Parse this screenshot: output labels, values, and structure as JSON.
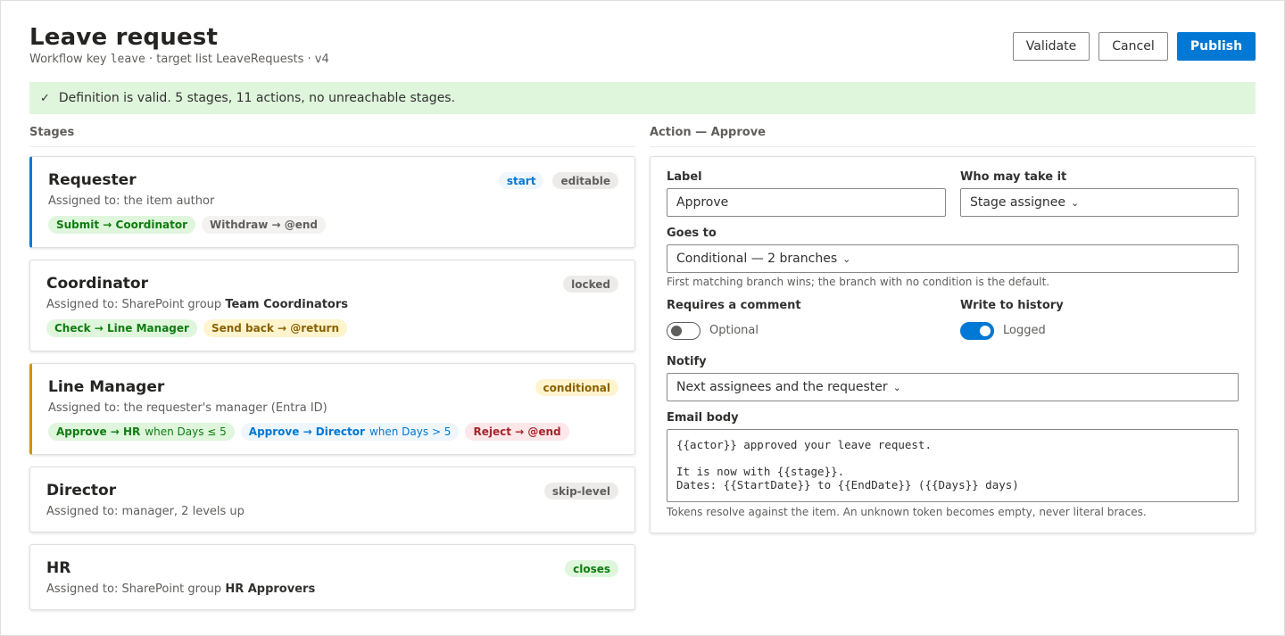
{
  "header": {
    "title": "Leave request",
    "subtitle_prefix": "Workflow key ",
    "subtitle_key": "leave",
    "subtitle_suffix": " · target list LeaveRequests · v4"
  },
  "toolbar": {
    "validate_label": "Validate",
    "cancel_label": "Cancel",
    "publish_label": "Publish"
  },
  "banner": {
    "check": "✓",
    "text": "Definition is valid. 5 stages, 11 actions, no unreachable stages."
  },
  "stages_heading": "Stages",
  "stages": [
    {
      "name": "Requester",
      "assigned_prefix": "Assigned to: the item author",
      "assigned_bold": "",
      "badges": [
        "start",
        "editable"
      ],
      "actions": [
        {
          "label": "Submit → Coordinator",
          "cond": ""
        },
        {
          "label": "Withdraw → @end",
          "cond": ""
        }
      ]
    },
    {
      "name": "Coordinator",
      "assigned_prefix": "Assigned to: SharePoint group ",
      "assigned_bold": "Team Coordinators",
      "badges": [
        "locked"
      ],
      "actions": [
        {
          "label": "Check → Line Manager",
          "cond": ""
        },
        {
          "label": "Send back → @return",
          "cond": ""
        }
      ]
    },
    {
      "name": "Line Manager",
      "assigned_prefix": "Assigned to: the requester's manager (Entra ID)",
      "assigned_bold": "",
      "badges": [
        "conditional"
      ],
      "actions": [
        {
          "label": "Approve → HR",
          "cond": "when Days ≤ 5"
        },
        {
          "label": "Approve → Director",
          "cond": "when Days > 5"
        },
        {
          "label": "Reject → @end",
          "cond": ""
        }
      ]
    },
    {
      "name": "Director",
      "assigned_prefix": "Assigned to: manager, 2 levels up",
      "assigned_bold": "",
      "badges": [
        "skip-level"
      ],
      "actions": []
    },
    {
      "name": "HR",
      "assigned_prefix": "Assigned to: SharePoint group ",
      "assigned_bold": "HR Approvers",
      "badges": [
        "closes"
      ],
      "actions": []
    }
  ],
  "action_panel": {
    "heading": "Action — Approve",
    "label_field": {
      "label": "Label",
      "value": "Approve"
    },
    "who_field": {
      "label": "Who may take it",
      "value": "Stage assignee",
      "chevron": "⌄"
    },
    "goes_to": {
      "label": "Goes to",
      "value": "Conditional — 2 branches",
      "chevron": "⌄",
      "hint": "First matching branch wins; the branch with no condition is the default."
    },
    "requires_comment": {
      "label": "Requires a comment",
      "state": "Optional",
      "on": false
    },
    "write_history": {
      "label": "Write to history",
      "state": "Logged",
      "on": true
    },
    "notify": {
      "label": "Notify",
      "value": "Next assignees and the requester",
      "chevron": "⌄"
    },
    "email_body": {
      "label": "Email body",
      "value": "{{actor}} approved your leave request.\n\nIt is now with {{stage}}.\nDates: {{StartDate}} to {{EndDate}} ({{Days}} days)",
      "hint": "Tokens resolve against the item. An unknown token becomes empty, never literal braces."
    }
  },
  "colors": {
    "accent": "#0078d4",
    "success_bg": "#dff6dd",
    "warning_border": "#d29200"
  }
}
